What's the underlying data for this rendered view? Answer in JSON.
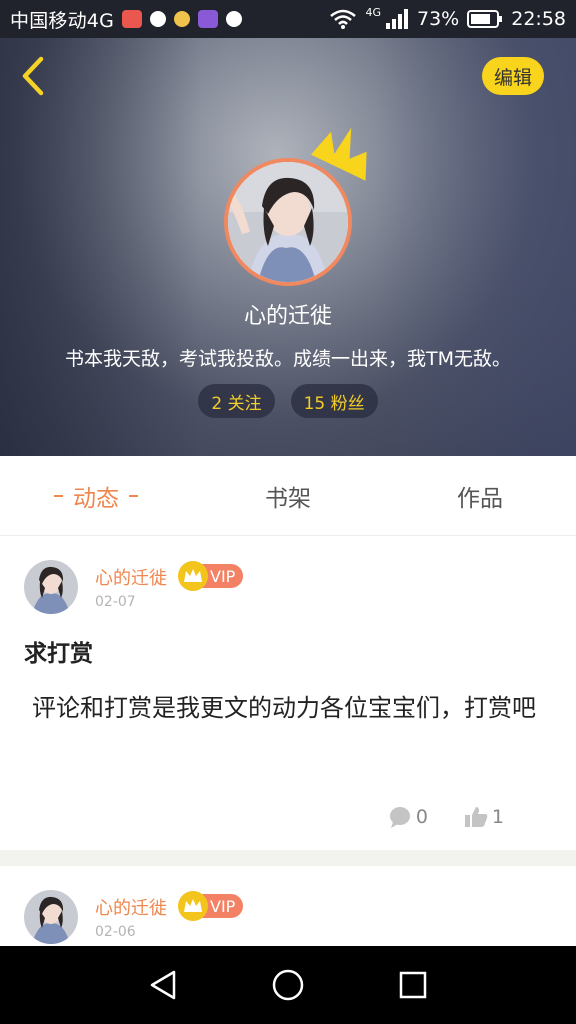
{
  "status_bar": {
    "carrier": "中国移动4G",
    "net_type": "4G",
    "battery": "73%",
    "time": "22:58"
  },
  "header": {
    "back_icon": "chevron-left-icon",
    "edit_label": "编辑",
    "name": "心的迁徙",
    "bio": "书本我天敌，考试我投敌。成绩一出来，我TM无敌。",
    "following_label": "2 关注",
    "followers_label": "15 粉丝",
    "colors": {
      "accent": "#f0874f",
      "pill_text": "#f3cd2a",
      "edit_bg": "#f8d41c"
    }
  },
  "tabs": [
    {
      "label": "动态",
      "active": true
    },
    {
      "label": "书架",
      "active": false
    },
    {
      "label": "作品",
      "active": false
    }
  ],
  "posts": [
    {
      "author": "心的迁徙",
      "badge": "VIP",
      "date": "02-07",
      "title": "求打赏",
      "body": "评论和打赏是我更文的动力各位宝宝们，打赏吧",
      "comments": "0",
      "likes": "1"
    },
    {
      "author": "心的迁徙",
      "badge": "VIP",
      "date": "02-06"
    }
  ],
  "nav": {
    "back": "triangle-back-icon",
    "home": "circle-home-icon",
    "recent": "square-recent-icon"
  }
}
